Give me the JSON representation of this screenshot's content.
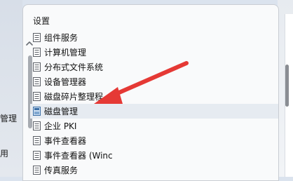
{
  "background": {
    "left_labels": [
      "管理",
      "用"
    ]
  },
  "panel": {
    "title": "设置",
    "items": [
      {
        "label": "组件服务",
        "icon": "document-icon"
      },
      {
        "label": "计算机管理",
        "icon": "document-icon"
      },
      {
        "label": "分布式文件系统",
        "icon": "document-icon"
      },
      {
        "label": "设备管理器",
        "icon": "document-icon"
      },
      {
        "label": "磁盘碎片整理程",
        "icon": "document-icon"
      },
      {
        "label": "磁盘管理",
        "icon": "disk-icon",
        "selected": true
      },
      {
        "label": "企业 PKI",
        "icon": "document-icon"
      },
      {
        "label": "事件查看器",
        "icon": "document-icon"
      },
      {
        "label": "事件查看器 (Winc",
        "icon": "document-icon"
      },
      {
        "label": "传真服务",
        "icon": "document-icon"
      }
    ]
  },
  "colors": {
    "arrow": "#e53935",
    "selection": "#e6ebf1",
    "scrollbar": "#a7abb1"
  }
}
